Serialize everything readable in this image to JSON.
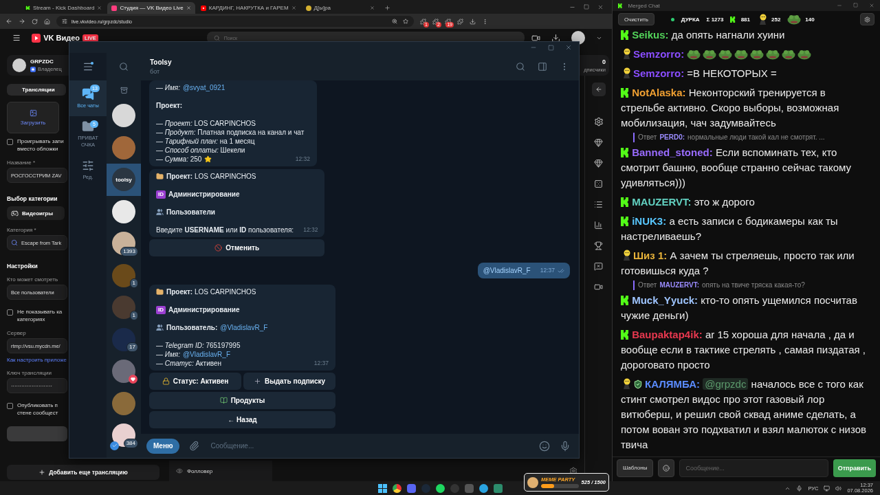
{
  "browser": {
    "tabs": [
      {
        "kind": "kick",
        "title": "Stream - Kick Dashboard",
        "selected": false
      },
      {
        "kind": "vk",
        "title": "Студия — VK Видео Live",
        "selected": true
      },
      {
        "kind": "youtube",
        "title": "КАРДИНГ, НАКРУТКА и ГАРЕМ",
        "selected": false
      },
      {
        "kind": "emoji",
        "title": "Д[ы]ра",
        "selected": false
      }
    ],
    "address": "live.vkvideo.ru/grpzdc/studio",
    "extension_badges": [
      "1",
      "2",
      "19"
    ],
    "site": {
      "logo": "VK Видео",
      "live_badge": "LIVE",
      "search_placeholder": "Поиск"
    },
    "channel": {
      "name": "GRPZDC",
      "role": "Владелец"
    },
    "stats": {
      "value": "0",
      "label": "дписчики"
    },
    "studio": {
      "tab": "Трансляции",
      "upload": "Загрузить",
      "items": [
        {
          "kind": "checkbox",
          "lines": [
            "Проигрывать запи",
            "вместо обложки"
          ],
          "checked": false
        },
        {
          "kind": "label",
          "text": "Название *"
        },
        {
          "kind": "field",
          "value": "РОСГОССТРИМ ZAV"
        },
        {
          "kind": "heading",
          "text": "Выбор категории"
        },
        {
          "kind": "chip",
          "text": "Видеоигры"
        },
        {
          "kind": "label",
          "text": "Категория *"
        },
        {
          "kind": "search_field",
          "value": "Escape from Tark"
        },
        {
          "kind": "heading",
          "text": "Настройки"
        },
        {
          "kind": "label",
          "text": "Кто может смотреть"
        },
        {
          "kind": "field",
          "value": "Все пользователи"
        },
        {
          "kind": "checkbox",
          "lines": [
            "Не показывать ка",
            "категориях"
          ],
          "checked": false
        },
        {
          "kind": "label",
          "text": "Сервер"
        },
        {
          "kind": "field",
          "value": "rtmp://vsu.mycdn.me/"
        },
        {
          "kind": "link",
          "text": "Как настроить приложе"
        },
        {
          "kind": "label",
          "text": "Ключ трансляции"
        },
        {
          "kind": "field",
          "value": "························"
        },
        {
          "kind": "checkbox",
          "lines": [
            "Опубликовать п",
            "стене сообщест"
          ],
          "checked": false
        },
        {
          "kind": "blank_button"
        }
      ],
      "add_button": "Добавить еще трансляцию"
    },
    "activity": {
      "label": "Фолловер"
    }
  },
  "telegram": {
    "folders": [
      {
        "kind": "chats",
        "label": "Все чаты",
        "badge": "13",
        "selected": true
      },
      {
        "kind": "folder",
        "label": "ПРИВАТ ОЧКА",
        "badge": "5",
        "selected": false
      },
      {
        "kind": "edit",
        "label": "Ред.",
        "selected": false
      }
    ],
    "chats": [
      {
        "selected": false,
        "heart": false,
        "verified": false
      },
      {
        "selected": false,
        "heart": false,
        "verified": false
      },
      {
        "selected": true,
        "logo": "toolsy",
        "heart": false,
        "verified": false
      },
      {
        "selected": false,
        "heart": false,
        "verified": false
      },
      {
        "selected": false,
        "badge": "1393",
        "heart": false,
        "verified": false
      },
      {
        "selected": false,
        "badge": "1",
        "heart": false,
        "verified": false
      },
      {
        "selected": false,
        "badge": "1",
        "heart": false,
        "verified": false
      },
      {
        "selected": false,
        "badge": "17",
        "heart": false,
        "verified": false
      },
      {
        "selected": false,
        "heart": true,
        "verified": false
      },
      {
        "selected": false,
        "heart": false,
        "verified": false
      },
      {
        "selected": false,
        "badge": "384",
        "heart": false,
        "verified": true
      }
    ],
    "chat": {
      "title": "Toolsy",
      "subtitle": "бот"
    },
    "messages": [
      {
        "kind": "incoming",
        "time": "12:32",
        "lines": [
          {
            "kind": "field",
            "dash": "—",
            "label": "Имя:",
            "value": "@svyat_0921",
            "link": true
          },
          {
            "kind": "gap"
          },
          {
            "kind": "heading",
            "text": "Проект:"
          },
          {
            "kind": "gap"
          },
          {
            "kind": "field",
            "dash": "—",
            "label": "Проект:",
            "value": "LOS CARPINCHOS",
            "link": false
          },
          {
            "kind": "field",
            "dash": "—",
            "label": "Продукт:",
            "value": "Платная подписка на канал и чат",
            "link": false
          },
          {
            "kind": "field",
            "dash": "—",
            "label": "Тарифный план:",
            "value": "на 1 месяц",
            "link": false
          },
          {
            "kind": "field",
            "dash": "—",
            "label": "Способ оплаты:",
            "value": "Шекели",
            "link": false
          },
          {
            "kind": "amount",
            "dash": "—",
            "label": "Сумма:",
            "value": "250"
          }
        ]
      },
      {
        "kind": "incoming",
        "time": "12:32",
        "lines": [
          {
            "kind": "folder_title",
            "label": "Проект:",
            "value": "LOS CARPINCHOS",
            "link": false
          },
          {
            "kind": "gap"
          },
          {
            "kind": "id_title",
            "badge": "ID",
            "label": "Администрирование"
          },
          {
            "kind": "gap"
          },
          {
            "kind": "users_title",
            "label": "Пользователи"
          },
          {
            "kind": "gap"
          },
          {
            "kind": "text",
            "text": "Введите **USERNAME** или **ID** пользователя:"
          }
        ],
        "keyboard": [
          [
            {
              "kind": "cancel",
              "label": "Отменить"
            }
          ]
        ]
      },
      {
        "kind": "outgoing",
        "time": "12:37",
        "read": true,
        "lines": [
          {
            "kind": "mention",
            "text": "@VladislavR_F"
          }
        ]
      },
      {
        "kind": "incoming",
        "time": "12:37",
        "lines": [
          {
            "kind": "folder_title",
            "label": "Проект:",
            "value": "LOS CARPINCHOS",
            "link": false
          },
          {
            "kind": "gap"
          },
          {
            "kind": "id_title",
            "badge": "ID",
            "label": "Администрирование"
          },
          {
            "kind": "gap"
          },
          {
            "kind": "users_title",
            "label": "Пользователь:",
            "value": "@VladislavR_F",
            "link": true
          },
          {
            "kind": "gap"
          },
          {
            "kind": "field",
            "dash": "—",
            "label": "Telegram ID:",
            "value": "765197995",
            "link": false
          },
          {
            "kind": "field",
            "dash": "—",
            "label": "Имя:",
            "value": "@VladislavR_F",
            "link": true
          },
          {
            "kind": "field",
            "dash": "—",
            "label": "Статус:",
            "value": "Активен",
            "link": false
          }
        ],
        "keyboard": [
          [
            {
              "kind": "lock",
              "label": "Статус: Активен"
            },
            {
              "kind": "add",
              "label": "Выдать подписку"
            }
          ],
          [
            {
              "kind": "products",
              "label": "Продукты"
            }
          ],
          [
            {
              "kind": "plain",
              "label": "← Назад"
            }
          ]
        ]
      }
    ],
    "composer": {
      "menu": "Меню",
      "placeholder": "Сообщение..."
    }
  },
  "merged_chat": {
    "title": "Merged Chat",
    "clear": "Очистить",
    "stream": {
      "name": "ДУРКА",
      "live": true
    },
    "counters": [
      {
        "kind": "total",
        "value": "Σ 1273"
      },
      {
        "kind": "kick",
        "value": "881"
      },
      {
        "kind": "figure",
        "value": "252"
      },
      {
        "kind": "frog",
        "value": "140"
      }
    ],
    "messages": [
      {
        "kind": "kick_message",
        "user": "Seikus:",
        "color": "#53d35a",
        "text": "да опять нагнали хуини"
      },
      {
        "kind": "figure_message",
        "user": "Semzorro:",
        "color": "#8a4dff",
        "emotes": [
          {
            "kind": "frog"
          },
          {
            "kind": "frog"
          },
          {
            "kind": "frog"
          },
          {
            "kind": "frog"
          },
          {
            "kind": "frog"
          },
          {
            "kind": "frog"
          },
          {
            "kind": "frog"
          },
          {
            "kind": "frog"
          }
        ]
      },
      {
        "kind": "figure_message",
        "user": "Semzorro:",
        "color": "#8a4dff",
        "text": "=В НЕКОТОРЫХ ="
      },
      {
        "kind": "kick_message",
        "user": "NotAlaska:",
        "color": "#f0a032",
        "text": "Неконторский тренируется в стрельбе активно. Скоро выборы, возможная мобилизация, чач задумвайтесь"
      },
      {
        "kind": "reply",
        "label": "Ответ",
        "user": "PERD0:",
        "text": "нормальные люди такой кал не смотрят. ..."
      },
      {
        "kind": "kick_message",
        "user": "Banned_stoned:",
        "color": "#9a6cff",
        "text": "Если вспоминать тех, кто смотрит башню, вообще странно сейчас такому удивляться)))"
      },
      {
        "kind": "kick_message",
        "user": "MAUZERVT:",
        "color": "#62d1c1",
        "text": "это ж дорого"
      },
      {
        "kind": "kick_message",
        "user": "iNUK3:",
        "color": "#58c7ff",
        "text": "а есть записи с бодикамеры как ты настреливаешь?"
      },
      {
        "kind": "figure_message",
        "user": "Шиз 1:",
        "color": "#e8b33a",
        "text": "А зачем ты стреляешь, просто так или готовишься куда ?"
      },
      {
        "kind": "reply",
        "label": "Ответ",
        "user": "MAUZERVT:",
        "text": "опять на твиче тряска какая-то?"
      },
      {
        "kind": "kick_message",
        "user": "Muck_Yyuck:",
        "color": "#9fc5ff",
        "text": "кто-то опять ущемился посчитав чужие деньги)"
      },
      {
        "kind": "kick_message",
        "user": "Baupaktap4ik:",
        "color": "#e8384f",
        "text": "ar 15 хороша для начала , да и вообще если в тактике стрелять , самая пиздатая , дороговато просто"
      },
      {
        "kind": "figure_message",
        "shield": true,
        "user": "КАЛЯМБА:",
        "color": "#5b8cff",
        "mention": "@grpzdc",
        "text": "началось все с того как стинт смотрел видос про этот газовый лор витюберш, и решил свой сквад аниме сделать, а потом вован это подхватил и взял малюток с низов твича"
      }
    ],
    "footer": {
      "templates": "Шаблоны",
      "placeholder": "Сообщение...",
      "send": "Отправить"
    }
  },
  "taskbar": {
    "widget": {
      "title": "MEME PARTY",
      "reading": "525 / 1500",
      "level": 0.35
    },
    "language": "РУС",
    "time": "12:37",
    "date": "07.08.2026"
  }
}
